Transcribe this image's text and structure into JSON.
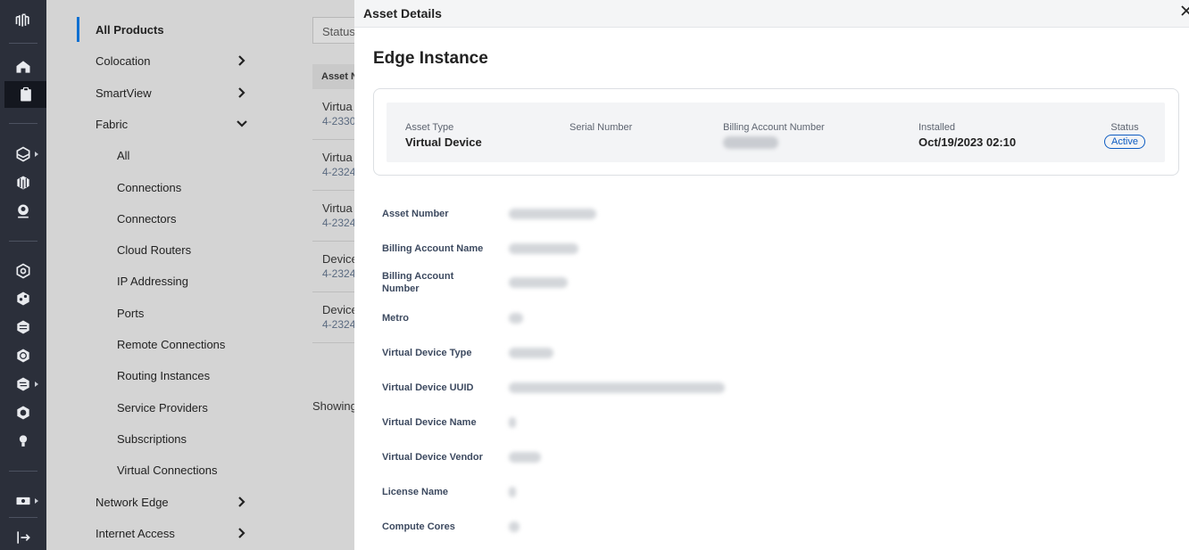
{
  "rail": {
    "icons": [
      "logo-icon",
      "home-icon",
      "clipboard-icon",
      "stack-icon",
      "cube-icon",
      "gear-person-icon",
      "network-icon",
      "share-icon",
      "layers-icon",
      "globe-icon",
      "swap-icon",
      "clock-icon",
      "lightbulb-icon",
      "money-icon",
      "logout-icon"
    ]
  },
  "nav": {
    "items": [
      {
        "label": "All Products",
        "level": "top",
        "selected": true
      },
      {
        "label": "Colocation",
        "level": "top",
        "chevron": "right"
      },
      {
        "label": "SmartView",
        "level": "top",
        "chevron": "right"
      },
      {
        "label": "Fabric",
        "level": "top",
        "chevron": "down"
      },
      {
        "label": "All",
        "level": "sub"
      },
      {
        "label": "Connections",
        "level": "sub"
      },
      {
        "label": "Connectors",
        "level": "sub"
      },
      {
        "label": "Cloud Routers",
        "level": "sub"
      },
      {
        "label": "IP Addressing",
        "level": "sub"
      },
      {
        "label": "Ports",
        "level": "sub"
      },
      {
        "label": "Remote Connections",
        "level": "sub"
      },
      {
        "label": "Routing Instances",
        "level": "sub"
      },
      {
        "label": "Service Providers",
        "level": "sub"
      },
      {
        "label": "Subscriptions",
        "level": "sub"
      },
      {
        "label": "Virtual Connections",
        "level": "sub"
      },
      {
        "label": "Network Edge",
        "level": "top",
        "chevron": "right"
      },
      {
        "label": "Internet Access",
        "level": "top",
        "chevron": "right"
      }
    ]
  },
  "background": {
    "status_filter": "Status",
    "column_header": "Asset N",
    "rows": [
      {
        "name": "Virtua",
        "number": "4-2330"
      },
      {
        "name": "Virtua",
        "number": "4-2324"
      },
      {
        "name": "Virtua",
        "number": "4-2324"
      },
      {
        "name": "Device",
        "number": "4-2324"
      },
      {
        "name": "Device",
        "number": "4-2324"
      }
    ],
    "showing": "Showing"
  },
  "panel": {
    "header_title": "Asset Details",
    "heading": "Edge Instance",
    "summary": {
      "asset_type_label": "Asset Type",
      "asset_type_value": "Virtual Device",
      "serial_label": "Serial Number",
      "billing_label": "Billing Account Number",
      "installed_label": "Installed",
      "installed_value": "Oct/19/2023 02:10",
      "status_label": "Status",
      "status_value": "Active"
    },
    "fields": [
      {
        "label": "Asset Number"
      },
      {
        "label": "Billing Account Name"
      },
      {
        "label": "Billing Account Number"
      },
      {
        "label": "Metro"
      },
      {
        "label": "Virtual Device Type"
      },
      {
        "label": "Virtual Device UUID"
      },
      {
        "label": "Virtual Device Name"
      },
      {
        "label": "Virtual Device Vendor"
      },
      {
        "label": "License Name"
      },
      {
        "label": "Compute Cores"
      }
    ]
  },
  "colors": {
    "accent": "#0d6fd1",
    "rail": "#2b2f3a",
    "badge": "#0d5cc2"
  }
}
